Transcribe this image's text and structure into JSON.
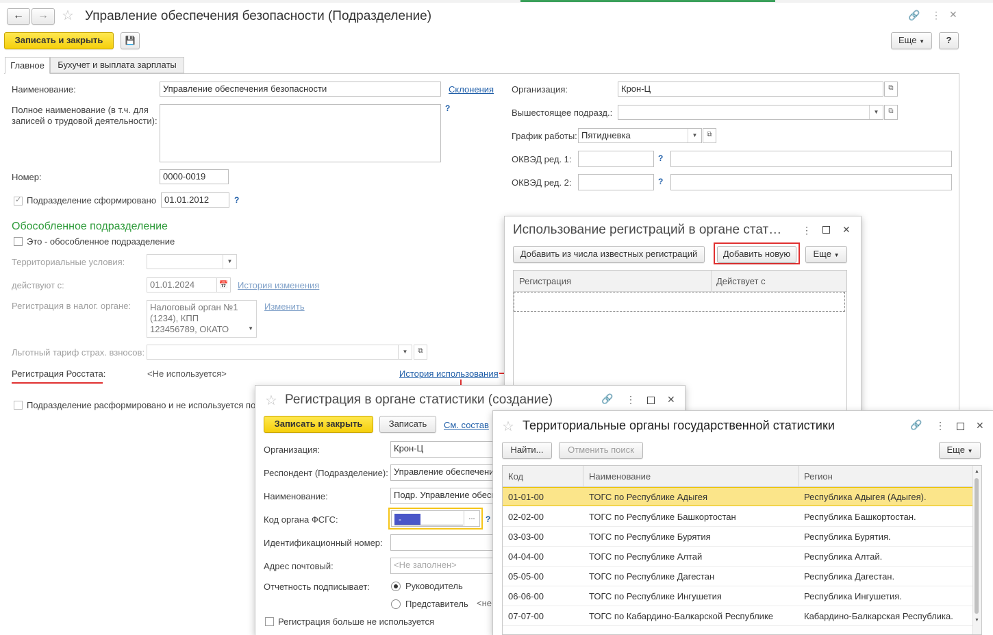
{
  "main": {
    "title": "Управление обеспечения безопасности (Подразделение)",
    "save_close": "Записать и закрыть",
    "more": "Еще",
    "help": "?",
    "tabs": [
      "Главное",
      "Бухучет и выплата зарплаты"
    ],
    "name_label": "Наименование:",
    "name_value": "Управление обеспечения безопасности",
    "declension_link": "Склонения",
    "fullname_label": "Полное наименование (в т.ч. для записей о трудовой деятельности):",
    "number_label": "Номер:",
    "number_value": "0000-0019",
    "formed_label": "Подразделение сформировано",
    "formed_date": "01.01.2012",
    "org_label": "Организация:",
    "org_value": "Крон-Ц",
    "parent_label": "Вышестоящее подразд.:",
    "schedule_label": "График работы:",
    "schedule_value": "Пятидневка",
    "okved1_label": "ОКВЭД ред. 1:",
    "okved2_label": "ОКВЭД ред. 2:",
    "separate_header": "Обособленное подразделение",
    "separate_check": "Это - обособленное подразделение",
    "terr_label": "Территориальные условия:",
    "valid_from_label": "действуют с:",
    "valid_from_value": "01.01.2024",
    "history_link": "История изменения",
    "tax_reg_label": "Регистрация в налог. органе:",
    "tax_reg_value": [
      "Налоговый орган №1",
      "(1234), КПП",
      "123456789, ОКАТО"
    ],
    "change_link": "Изменить",
    "tariff_label": "Льготный тариф страх. взносов:",
    "rosstat_label": "Регистрация Росстата:",
    "rosstat_value": "<Не используется>",
    "usage_history_link": "История использования",
    "disbanded_label": "Подразделение расформировано и не используется по"
  },
  "usage_win": {
    "title": "Использование регистраций в органе стат…",
    "add_known": "Добавить из числа известных регистраций",
    "add_new": "Добавить новую",
    "more": "Еще",
    "columns": [
      "Регистрация",
      "Действует с"
    ]
  },
  "reg_win": {
    "title": "Регистрация в органе статистики (создание)",
    "save_close": "Записать и закрыть",
    "save": "Записать",
    "composition_link": "См. состав",
    "org_label": "Организация:",
    "org_value": "Крон-Ц",
    "respondent_label": "Респондент (Подразделение):",
    "respondent_value": "Управление обеспечени",
    "name_label": "Наименование:",
    "name_value": "Подр. Управление обесп",
    "fsgs_label": "Код органа ФСГС:",
    "fsgs_value": "-",
    "idnum_label": "Идентификационный номер:",
    "address_label": "Адрес почтовый:",
    "address_placeholder": "<Не заполнен>",
    "signs_label": "Отчетность подписывает:",
    "radio_head": "Руководитель",
    "radio_rep": "Представитель",
    "radio_rep_tail": "<не",
    "no_longer_used": "Регистрация больше не используется"
  },
  "terr_win": {
    "title": "Территориальные органы государственной статистики",
    "find": "Найти...",
    "cancel_search": "Отменить поиск",
    "more": "Еще",
    "columns": [
      "Код",
      "Наименование",
      "Регион"
    ],
    "rows": [
      {
        "code": "01-01-00",
        "name": "ТОГС по Республике Адыгея",
        "region": "Республика Адыгея (Адыгея)."
      },
      {
        "code": "02-02-00",
        "name": "ТОГС по Республике Башкортостан",
        "region": "Республика Башкортостан."
      },
      {
        "code": "03-03-00",
        "name": "ТОГС по Республике Бурятия",
        "region": "Республика Бурятия."
      },
      {
        "code": "04-04-00",
        "name": "ТОГС по Республике Алтай",
        "region": "Республика Алтай."
      },
      {
        "code": "05-05-00",
        "name": "ТОГС по Республике Дагестан",
        "region": "Республика Дагестан."
      },
      {
        "code": "06-06-00",
        "name": "ТОГС по Республике Ингушетия",
        "region": "Республика Ингушетия."
      },
      {
        "code": "07-07-00",
        "name": "ТОГС по Кабардино-Балкарской Республике",
        "region": "Кабардино-Балкарская Республика."
      }
    ]
  },
  "colors": {
    "accent_yellow": "#f5cf0c",
    "selected_row": "#fbe58a",
    "link": "#1f5ea8",
    "group_green": "#2e9b3a",
    "highlight_red": "#e03030"
  },
  "icons": [
    "back-arrow-icon",
    "forward-arrow-icon",
    "star-icon",
    "link-icon",
    "kebab-icon",
    "maximize-icon",
    "close-icon",
    "save-disk-icon",
    "calendar-icon",
    "open-form-icon",
    "chevron-down-icon"
  ]
}
